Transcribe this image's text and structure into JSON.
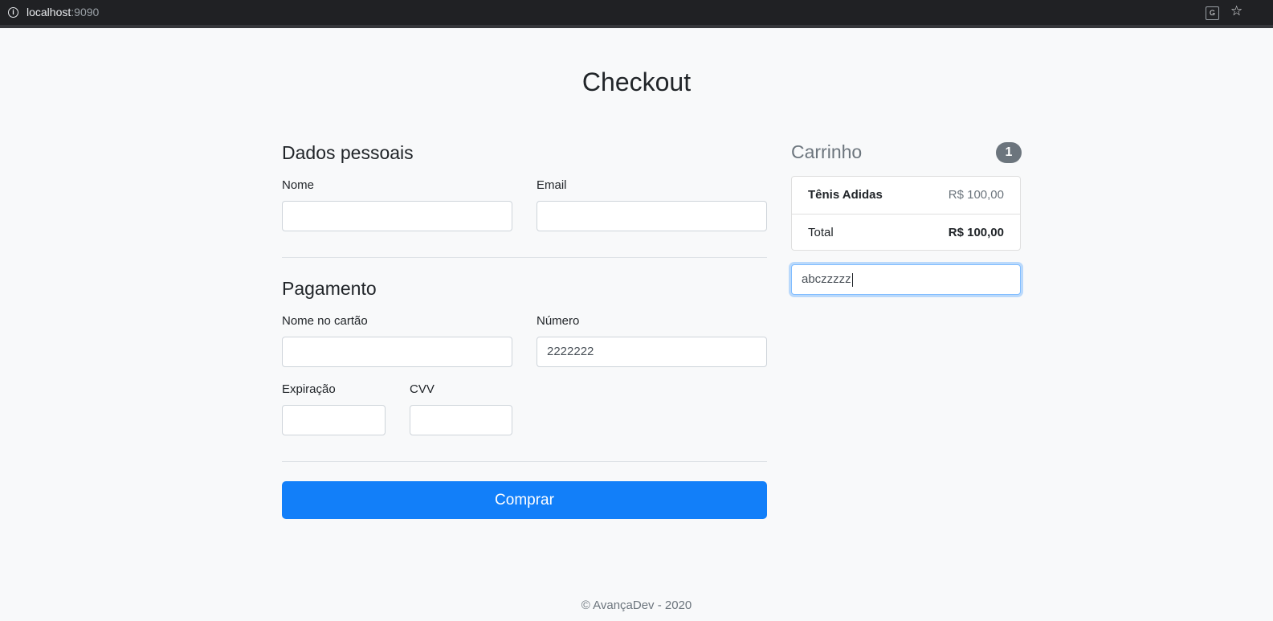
{
  "browser": {
    "host": "localhost",
    "port": ":9090"
  },
  "page": {
    "title": "Checkout"
  },
  "personal": {
    "title": "Dados pessoais",
    "name_label": "Nome",
    "name_value": "",
    "email_label": "Email",
    "email_value": ""
  },
  "payment": {
    "title": "Pagamento",
    "card_name_label": "Nome no cartão",
    "card_name_value": "",
    "number_label": "Número",
    "number_value": "2222222",
    "expiration_label": "Expiração",
    "expiration_value": "",
    "cvv_label": "CVV",
    "cvv_value": ""
  },
  "actions": {
    "buy_label": "Comprar"
  },
  "cart": {
    "title": "Carrinho",
    "count": "1",
    "items": [
      {
        "name": "Tênis Adidas",
        "price": "R$ 100,00"
      }
    ],
    "total_label": "Total",
    "total_value": "R$ 100,00",
    "coupon_value": "abczzzzz"
  },
  "footer": {
    "text": "© AvançaDev - 2020"
  },
  "colors": {
    "primary": "#127ff9",
    "badge": "#6c757d",
    "background": "#f8f9fa"
  }
}
